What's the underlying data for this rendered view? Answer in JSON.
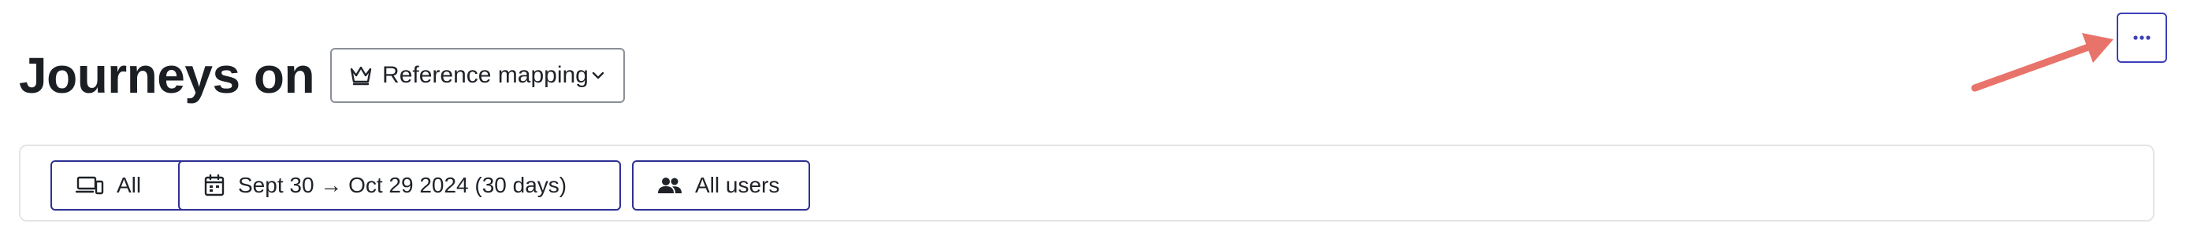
{
  "header": {
    "title": "Journeys on",
    "mapping_select": {
      "label": "Reference mapping",
      "icon": "crown-icon",
      "chevron_icon": "chevron-down-icon"
    },
    "more_button": {
      "icon": "ellipsis-icon",
      "border_color": "#3b3fb6"
    }
  },
  "annotation": {
    "arrow_color": "#e8736a"
  },
  "filters": {
    "device": {
      "label": "All",
      "icon": "devices-icon"
    },
    "date_range": {
      "label": "Sept 30 → Oct 29 2024 (30 days)",
      "icon": "calendar-icon"
    },
    "users": {
      "label": "All users",
      "icon": "users-icon"
    },
    "chip_border_color": "#2e3192"
  }
}
